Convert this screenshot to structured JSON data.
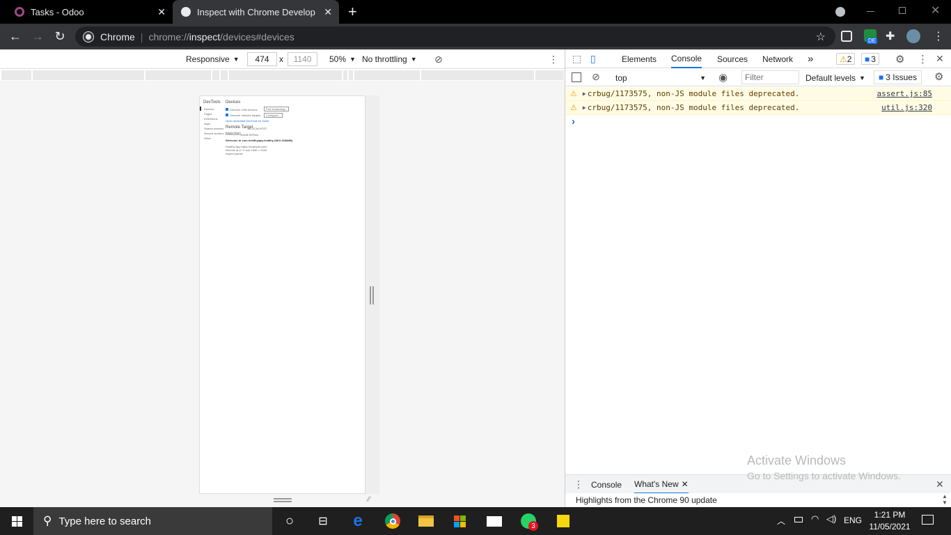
{
  "tabs": [
    {
      "title": "Tasks - Odoo",
      "close": "✕"
    },
    {
      "title": "Inspect with Chrome Developer T",
      "close": "✕"
    }
  ],
  "new_tab": "+",
  "address": {
    "label": "Chrome",
    "url_prefix": "chrome://",
    "url_host": "inspect",
    "url_path": "/devices#devices"
  },
  "extension_badge": "DE",
  "device_toolbar": {
    "device": "Responsive",
    "width": "474",
    "times": "x",
    "height": "1140",
    "zoom": "50%",
    "throttling": "No throttling"
  },
  "mini_page": {
    "brand": "DevTools",
    "heading": "Devices",
    "nav": [
      "Devices",
      "Pages",
      "Extensions",
      "Apps",
      "Shared workers",
      "Service workers",
      "Other"
    ],
    "opt1": "Discover USB devices",
    "opt2": "Discover network targets",
    "btn1": "Port forwarding...",
    "btn2": "Configure...",
    "link": "Open dedicated DevTools for Node",
    "remote_heading": "Remote Target",
    "remote_sub": "#LOCALHOST",
    "device_name": "RMX2001",
    "device_sub": "#ADB:SERIAL",
    "browser_line": "Welcome to com.healthyapp.healthy (88.0.4324.93)",
    "trace": "trace",
    "detail1": "Healthy App  https://example.com/",
    "detail2": "Remote at 0 / 0  size 1080 × 2340",
    "detail3": "inspect   pause"
  },
  "devtools": {
    "tabs": [
      "Elements",
      "Console",
      "Sources",
      "Network"
    ],
    "more": "»",
    "warn_count": "2",
    "msg_count": "3",
    "context": "top",
    "filter_placeholder": "Filter",
    "levels": "Default levels",
    "issues": "3 Issues",
    "messages": [
      {
        "text": "crbug/1173575, non-JS module files deprecated.",
        "source": "assert.js:85"
      },
      {
        "text": "crbug/1173575, non-JS module files deprecated.",
        "source": "util.js:320"
      }
    ],
    "prompt": "›",
    "drawer_tabs": [
      "Console",
      "What's New"
    ],
    "drawer_text": "Highlights from the Chrome 90 update"
  },
  "activate": {
    "title": "Activate Windows",
    "sub": "Go to Settings to activate Windows."
  },
  "taskbar": {
    "search": "Type here to search",
    "whatsapp_badge": "3",
    "lang": "ENG",
    "time": "1:21 PM",
    "date": "11/05/2021"
  },
  "colors": {
    "accent": "#1a73e8",
    "warn_bg": "#fffbe5",
    "tab_active": "#35363a"
  }
}
